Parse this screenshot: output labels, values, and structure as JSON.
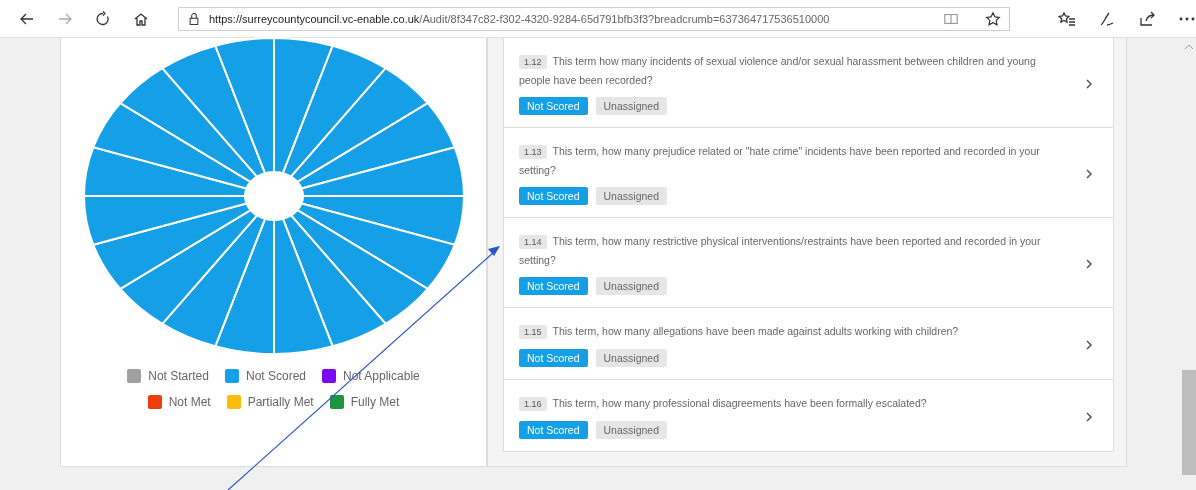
{
  "browser": {
    "url_host": "https://surreycountycouncil.vc-enable.co.uk",
    "url_path": "/Audit/8f347c82-f302-4320-9284-65d791bfb3f3?breadcrumb=637364717536510000"
  },
  "chart": {
    "segments": [
      {
        "color": "#159fe6"
      },
      {
        "color": "#159fe6"
      },
      {
        "color": "#159fe6"
      },
      {
        "color": "#159fe6"
      },
      {
        "color": "#159fe6"
      },
      {
        "color": "#159fe6"
      },
      {
        "color": "#159fe6"
      },
      {
        "color": "#159fe6"
      },
      {
        "color": "#159fe6"
      },
      {
        "color": "#159fe6"
      },
      {
        "color": "#159fe6"
      },
      {
        "color": "#159fe6"
      },
      {
        "color": "#159fe6"
      },
      {
        "color": "#159fe6"
      },
      {
        "color": "#159fe6"
      },
      {
        "color": "#159fe6"
      },
      {
        "color": "#159fe6"
      },
      {
        "color": "#159fe6"
      },
      {
        "color": "#159fe6"
      },
      {
        "color": "#159fe6"
      }
    ],
    "legend": [
      {
        "label": "Not Started",
        "color": "#a0a0a0"
      },
      {
        "label": "Not Scored",
        "color": "#159fe6"
      },
      {
        "label": "Not Applicable",
        "color": "#7a0bf0"
      },
      {
        "label": "Not Met",
        "color": "#f03c0a"
      },
      {
        "label": "Partially Met",
        "color": "#fbbd0a"
      },
      {
        "label": "Fully Met",
        "color": "#1c9440"
      }
    ]
  },
  "questions": [
    {
      "number": "1.12",
      "text": "This term how many incidents of sexual violence and/or sexual harassment between children and young people have been recorded?",
      "status": "Not Scored",
      "assignee": "Unassigned"
    },
    {
      "number": "1.13",
      "text": "This term, how many prejudice related or \"hate crime\" incidents have been reported and recorded in your setting?",
      "status": "Not Scored",
      "assignee": "Unassigned"
    },
    {
      "number": "1.14",
      "text": "This term, how many restrictive physical interventions/restraints have been reported and recorded in your setting?",
      "status": "Not Scored",
      "assignee": "Unassigned"
    },
    {
      "number": "1.15",
      "text": "This term, how many allegations have been made against adults working with children?",
      "status": "Not Scored",
      "assignee": "Unassigned"
    },
    {
      "number": "1.16",
      "text": "This term, how many professional disagreements have been formally escalated?",
      "status": "Not Scored",
      "assignee": "Unassigned"
    }
  ]
}
